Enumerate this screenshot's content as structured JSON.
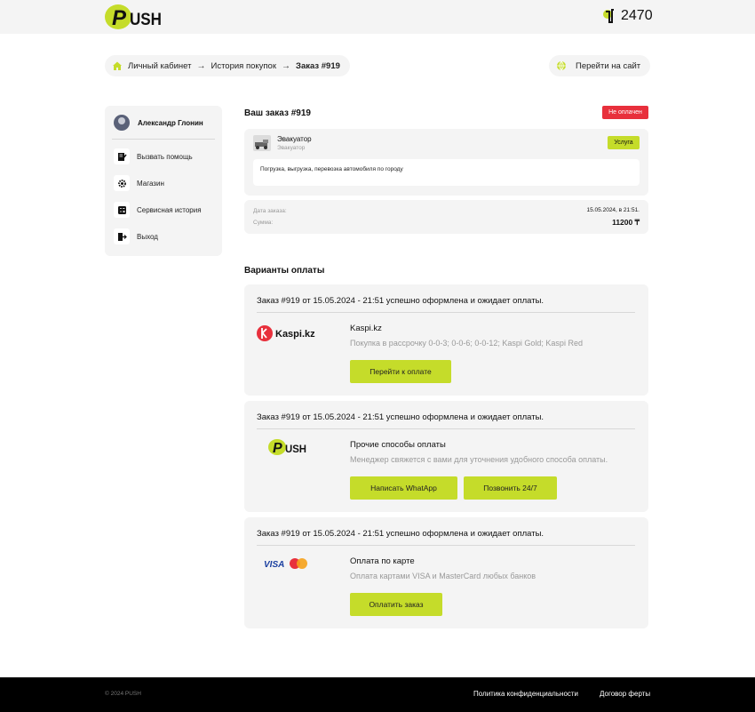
{
  "header": {
    "logo_text": "PUSH",
    "phone_short": "2470"
  },
  "breadcrumbs": {
    "items": [
      "Личный кабинет",
      "История покупок"
    ],
    "current": "Заказ #919"
  },
  "site_button": {
    "label": "Перейти на сайт"
  },
  "sidebar": {
    "user_name": "Александр Глонин",
    "items": [
      {
        "label": "Вызвать помощь",
        "icon": "document-edit-icon"
      },
      {
        "label": "Магазин",
        "icon": "gear-icon"
      },
      {
        "label": "Сервисная история",
        "icon": "calculator-icon"
      },
      {
        "label": "Выход",
        "icon": "logout-icon"
      }
    ]
  },
  "order": {
    "title": "Ваш заказ #919",
    "status": "Не оплачен",
    "status_color": "#e8303c",
    "item": {
      "name": "Эвакуатор",
      "category": "Эвакуатор",
      "badge": "Услуга",
      "description": "Погрузка, выгрузка, перевозка автомобиля по городу"
    },
    "date_label": "Дата заказа:",
    "date_value": "15.05.2024, в 21:51.",
    "sum_label": "Сумма:",
    "sum_value": "11200 ₸"
  },
  "payment": {
    "section_title": "Варианты оплаты",
    "options": [
      {
        "header": "Заказ #919 от 15.05.2024 - 21:51 успешно оформлена и ожидает оплаты.",
        "logo_text": "Kaspi.kz",
        "name": "Kaspi.kz",
        "description": "Покупка в рассрочку 0-0-3; 0-0-6; 0-0-12; Kaspi Gold; Kaspi Red",
        "buttons": [
          "Перейти к оплате"
        ]
      },
      {
        "header": "Заказ #919 от 15.05.2024 - 21:51 успешно оформлена и ожидает оплаты.",
        "logo_text": "PUSH",
        "name": "Прочие способы оплаты",
        "description": "Менеджер свяжется с вами для уточнения удобного способа оплаты.",
        "buttons": [
          "Написать WhatApp",
          "Позвонить 24/7"
        ]
      },
      {
        "header": "Заказ #919 от 15.05.2024 - 21:51 успешно оформлена и ожидает оплаты.",
        "logo_text": "VISA",
        "name": "Оплата по карте",
        "description": "Оплата картами VISA и MasterCard любых банков",
        "buttons": [
          "Оплатить заказ"
        ]
      }
    ]
  },
  "footer": {
    "copyright": "© 2024 PUSH",
    "privacy": "Политика конфиденциальности",
    "offer": "Договор ферты"
  },
  "colors": {
    "accent": "#c5dc2a",
    "panel": "#f4f4f4",
    "footer": "#000000"
  }
}
